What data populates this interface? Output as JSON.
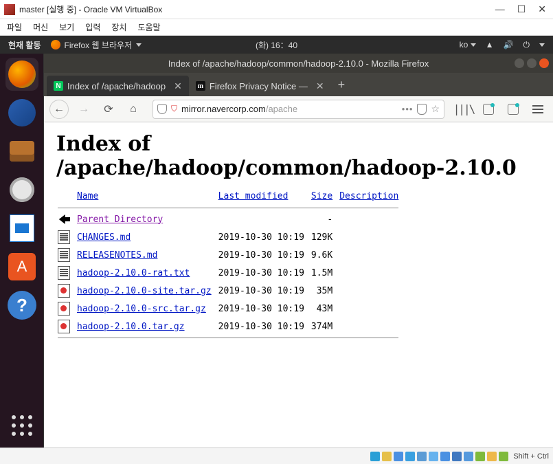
{
  "vb": {
    "title": "master [실행 중] - Oracle VM VirtualBox",
    "menu": [
      "파일",
      "머신",
      "보기",
      "입력",
      "장치",
      "도움말"
    ],
    "status_text": "Shift + Ctrl"
  },
  "gnome": {
    "activities": "현재 활동",
    "app": "Firefox 웹 브라우저",
    "clock": "(화)  16：40",
    "lang": "ko"
  },
  "ff": {
    "window_title": "Index of /apache/hadoop/common/hadoop-2.10.0 - Mozilla Firefox",
    "tabs": [
      {
        "label": "Index of /apache/hadoop",
        "fav": "N",
        "active": true
      },
      {
        "label": "Firefox Privacy Notice —",
        "fav": "m",
        "active": false
      }
    ],
    "url_host": "mirror.navercorp.com",
    "url_path": "/apache",
    "page_heading": "Index of /apache/hadoop/common/hadoop-2.10.0",
    "cols": {
      "name": "Name",
      "lm": "Last modified",
      "size": "Size",
      "desc": "Description"
    },
    "rows": [
      {
        "icon": "back",
        "name": "Parent Directory",
        "visited": true,
        "lm": "",
        "size": "-"
      },
      {
        "icon": "txt",
        "name": "CHANGES.md",
        "lm": "2019-10-30 10:19",
        "size": "129K"
      },
      {
        "icon": "txt",
        "name": "RELEASENOTES.md",
        "lm": "2019-10-30 10:19",
        "size": "9.6K"
      },
      {
        "icon": "txt",
        "name": "hadoop-2.10.0-rat.txt",
        "lm": "2019-10-30 10:19",
        "size": "1.5M"
      },
      {
        "icon": "gz",
        "name": "hadoop-2.10.0-site.tar.gz",
        "lm": "2019-10-30 10:19",
        "size": "35M"
      },
      {
        "icon": "gz",
        "name": "hadoop-2.10.0-src.tar.gz",
        "lm": "2019-10-30 10:19",
        "size": "43M"
      },
      {
        "icon": "gz",
        "name": "hadoop-2.10.0.tar.gz",
        "lm": "2019-10-30 10:19",
        "size": "374M"
      }
    ]
  }
}
